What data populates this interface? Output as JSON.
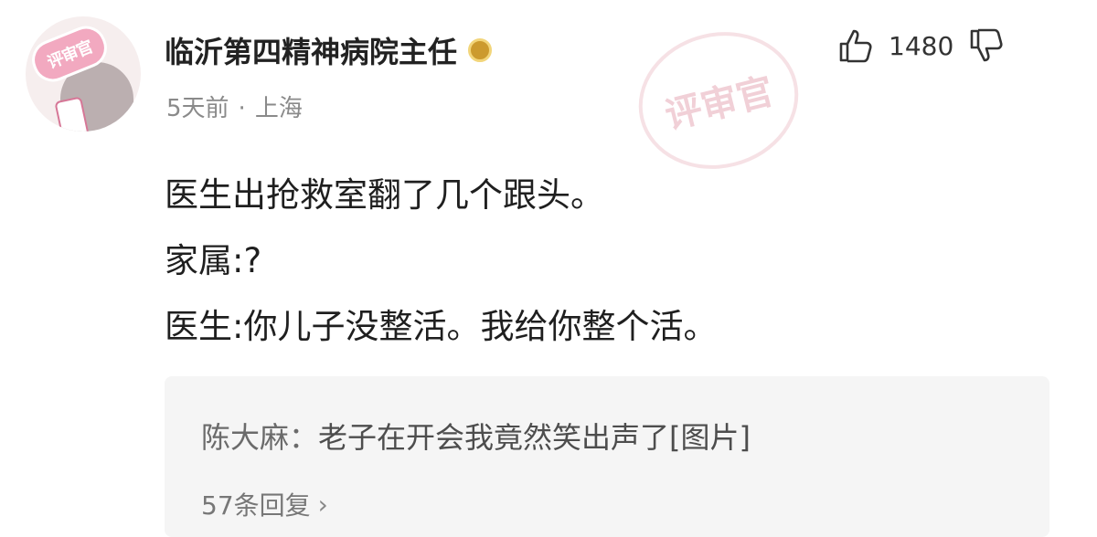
{
  "comment": {
    "username": "临沂第四精神病院主任",
    "time": "5天前",
    "separator": "·",
    "location": "上海",
    "avatar_badge_text": "评审官",
    "watermark_text": "评审官",
    "likes": "1480",
    "icons": {
      "like": "thumbs-up-icon",
      "dislike": "thumbs-down-icon",
      "badge": "user-badge-icon"
    },
    "content_lines": [
      "医生出抢救室翻了几个跟头。",
      "家属:?",
      "医生:你儿子没整活。我给你整个活。"
    ],
    "reply": {
      "author": "陈大麻：",
      "text": "老子在开会我竟然笑出声了[图片]",
      "count_label": "57条回复",
      "chevron": "›"
    }
  }
}
